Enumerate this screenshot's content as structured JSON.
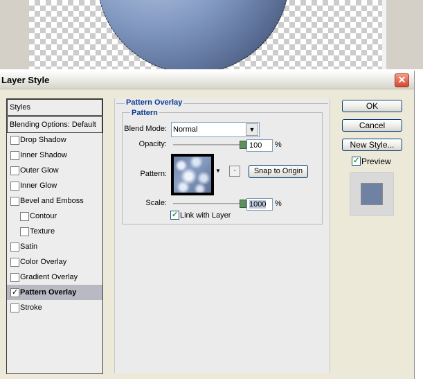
{
  "window": {
    "title": "Layer Style",
    "close_label": "✕"
  },
  "styles_panel": {
    "header": "Styles",
    "blending": "Blending Options: Default",
    "items": [
      {
        "label": "Drop Shadow",
        "checked": false,
        "indent": false,
        "selected": false
      },
      {
        "label": "Inner Shadow",
        "checked": false,
        "indent": false,
        "selected": false
      },
      {
        "label": "Outer Glow",
        "checked": false,
        "indent": false,
        "selected": false
      },
      {
        "label": "Inner Glow",
        "checked": false,
        "indent": false,
        "selected": false
      },
      {
        "label": "Bevel and Emboss",
        "checked": false,
        "indent": false,
        "selected": false
      },
      {
        "label": "Contour",
        "checked": false,
        "indent": true,
        "selected": false
      },
      {
        "label": "Texture",
        "checked": false,
        "indent": true,
        "selected": false
      },
      {
        "label": "Satin",
        "checked": false,
        "indent": false,
        "selected": false
      },
      {
        "label": "Color Overlay",
        "checked": false,
        "indent": false,
        "selected": false
      },
      {
        "label": "Gradient Overlay",
        "checked": false,
        "indent": false,
        "selected": false
      },
      {
        "label": "Pattern Overlay",
        "checked": true,
        "indent": false,
        "selected": true
      },
      {
        "label": "Stroke",
        "checked": false,
        "indent": false,
        "selected": false
      }
    ]
  },
  "pattern_overlay": {
    "section_title": "Pattern Overlay",
    "group_title": "Pattern",
    "blend_mode_label": "Blend Mode:",
    "blend_mode_value": "Normal",
    "opacity_label": "Opacity:",
    "opacity_value": "100",
    "opacity_level": 1.0,
    "percent": "%",
    "pattern_label": "Pattern:",
    "snap_label": "Snap to Origin",
    "scale_label": "Scale:",
    "scale_value": "1000",
    "scale_level": 1.0,
    "link_label": "Link with Layer",
    "link_checked": true
  },
  "actions": {
    "ok": "OK",
    "cancel": "Cancel",
    "new_style": "New Style...",
    "preview_label": "Preview",
    "preview_checked": true
  },
  "colors": {
    "accent_title": "#0a3a8f",
    "selected_row": "#b9b9c4",
    "preview_swatch": "#6f82a3"
  }
}
